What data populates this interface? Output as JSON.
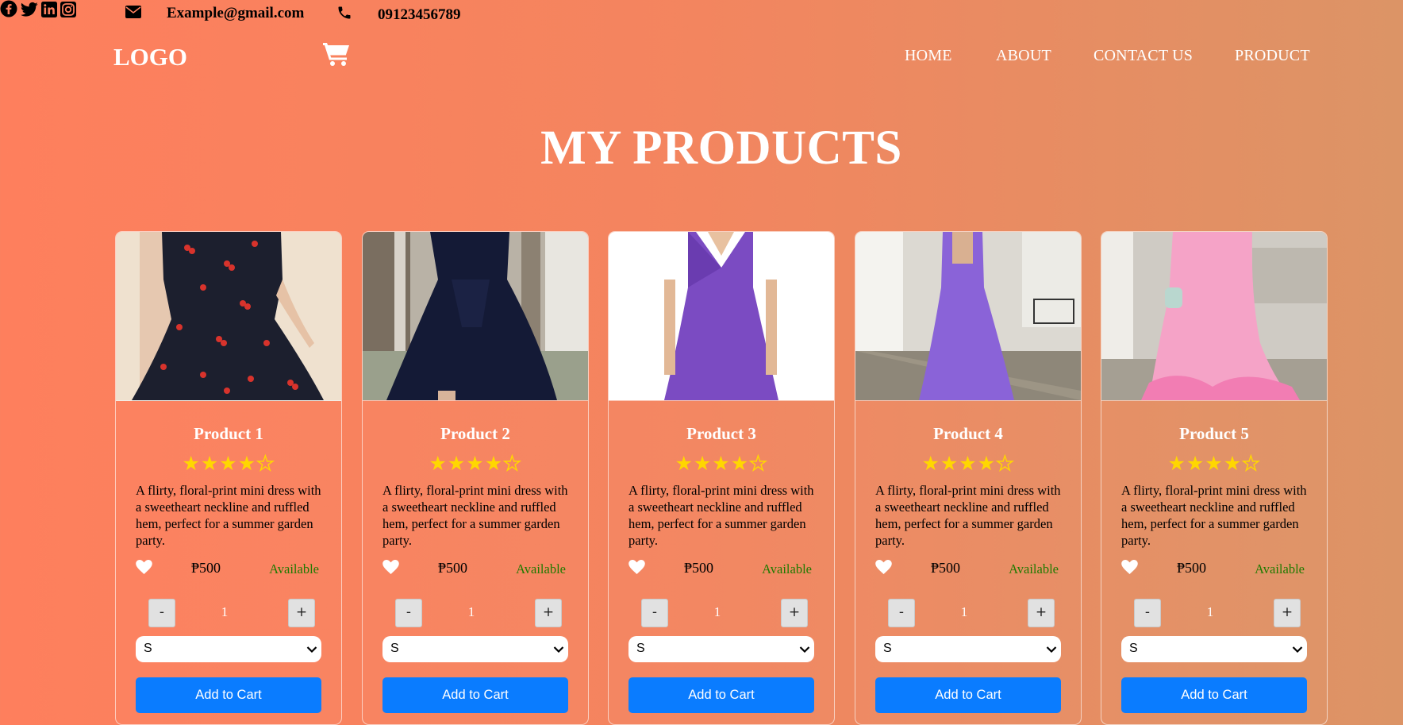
{
  "topbar": {
    "email": "Example@gmail.com",
    "phone": "09123456789",
    "icons": [
      "envelope-icon",
      "phone-icon"
    ],
    "socials": [
      "facebook-icon",
      "twitter-icon",
      "linkedin-icon",
      "instagram-icon"
    ]
  },
  "navbar": {
    "logo": "LOGO",
    "cart_icon": "shopping-cart-icon",
    "links": [
      "HOME",
      "ABOUT",
      "CONTACT US",
      "PRODUCT"
    ]
  },
  "main": {
    "title": "MY PRODUCTS",
    "products": [
      {
        "name": "Product 1",
        "rating": 4,
        "max_rating": 5,
        "description": "A flirty, floral-print mini dress with a sweetheart neckline and ruffled hem, perfect for a summer garden party.",
        "price": "₱500",
        "availability": "Available",
        "quantity": "1",
        "size": "S",
        "add_label": "Add to Cart",
        "image": "black-cherry-print-dress"
      },
      {
        "name": "Product 2",
        "rating": 4,
        "max_rating": 5,
        "description": "A flirty, floral-print mini dress with a sweetheart neckline and ruffled hem, perfect for a summer garden party.",
        "price": "₱500",
        "availability": "Available",
        "quantity": "1",
        "size": "S",
        "add_label": "Add to Cart",
        "image": "navy-dress"
      },
      {
        "name": "Product 3",
        "rating": 4,
        "max_rating": 5,
        "description": "A flirty, floral-print mini dress with a sweetheart neckline and ruffled hem, perfect for a summer garden party.",
        "price": "₱500",
        "availability": "Available",
        "quantity": "1",
        "size": "S",
        "add_label": "Add to Cart",
        "image": "purple-wrap-dress"
      },
      {
        "name": "Product 4",
        "rating": 4,
        "max_rating": 5,
        "description": "A flirty, floral-print mini dress with a sweetheart neckline and ruffled hem, perfect for a summer garden party.",
        "price": "₱500",
        "availability": "Available",
        "quantity": "1",
        "size": "S",
        "add_label": "Add to Cart",
        "image": "lavender-maxi-dress"
      },
      {
        "name": "Product 5",
        "rating": 4,
        "max_rating": 5,
        "description": "A flirty, floral-print mini dress with a sweetheart neckline and ruffled hem, perfect for a summer garden party.",
        "price": "₱500",
        "availability": "Available",
        "quantity": "1",
        "size": "S",
        "add_label": "Add to Cart",
        "image": "pink-ruffle-gown"
      }
    ],
    "qty_minus": "-",
    "qty_plus": "+"
  },
  "colors": {
    "bg_left": "#fe7f5d",
    "bg_right": "#dc9466",
    "star": "#ffd700",
    "available": "#1f7a00",
    "button": "#0a7cff"
  }
}
